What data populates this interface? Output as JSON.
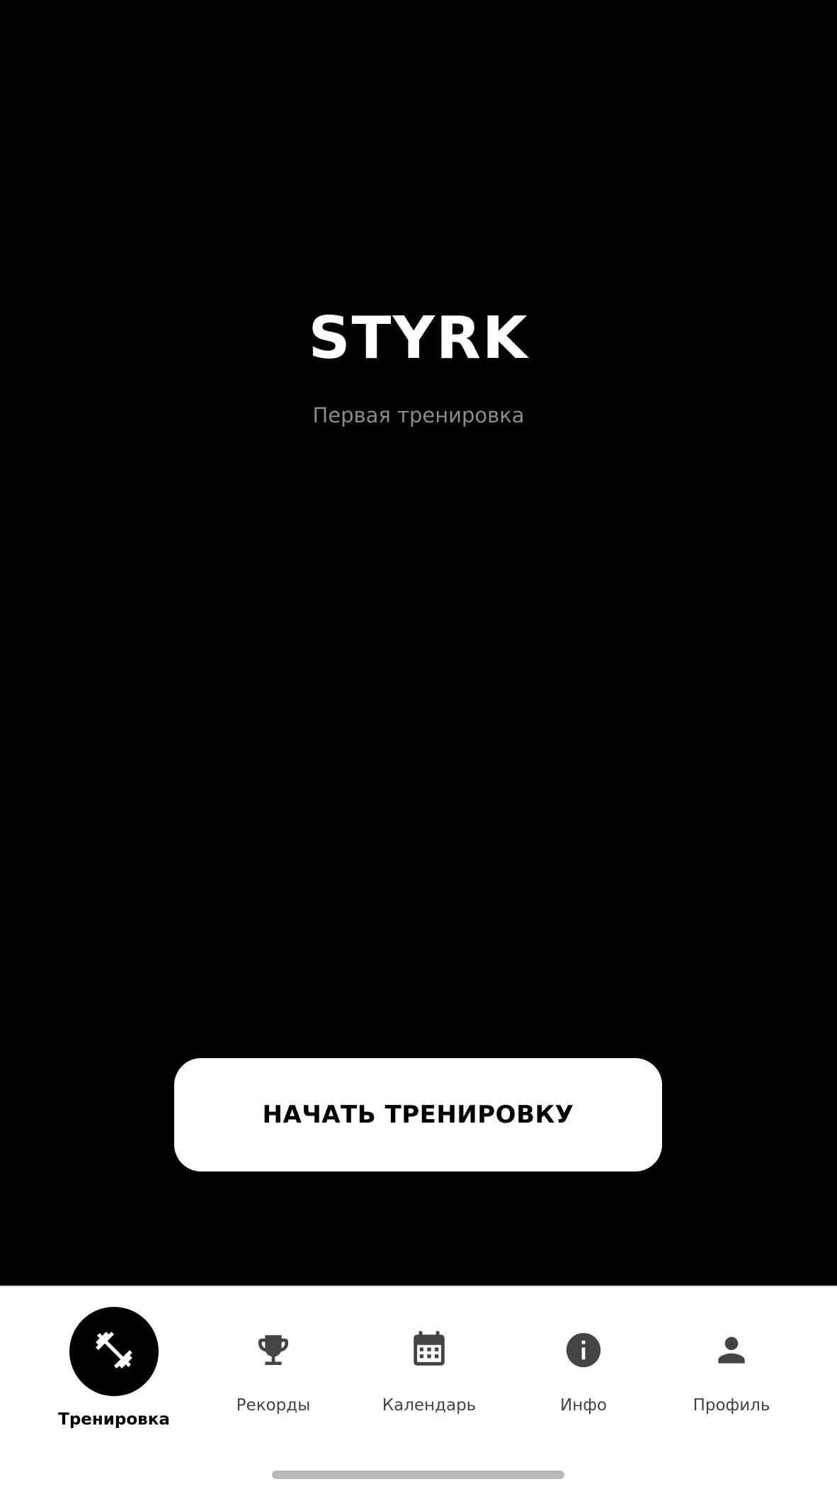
{
  "header": {
    "app_title": "STYRK",
    "subtitle": "Первая тренировка"
  },
  "main": {
    "start_button_label": "НАЧАТЬ ТРЕНИРОВКУ"
  },
  "bottom_nav": {
    "items": [
      {
        "label": "Тренировка",
        "icon": "dumbbell-icon",
        "active": true
      },
      {
        "label": "Рекорды",
        "icon": "trophy-icon",
        "active": false
      },
      {
        "label": "Календарь",
        "icon": "calendar-icon",
        "active": false
      },
      {
        "label": "Инфо",
        "icon": "info-icon",
        "active": false
      },
      {
        "label": "Профиль",
        "icon": "person-icon",
        "active": false
      }
    ]
  },
  "colors": {
    "background": "#000000",
    "accent": "#ffffff",
    "subtitle": "#8c8c8c",
    "nav_icon": "#444444"
  }
}
